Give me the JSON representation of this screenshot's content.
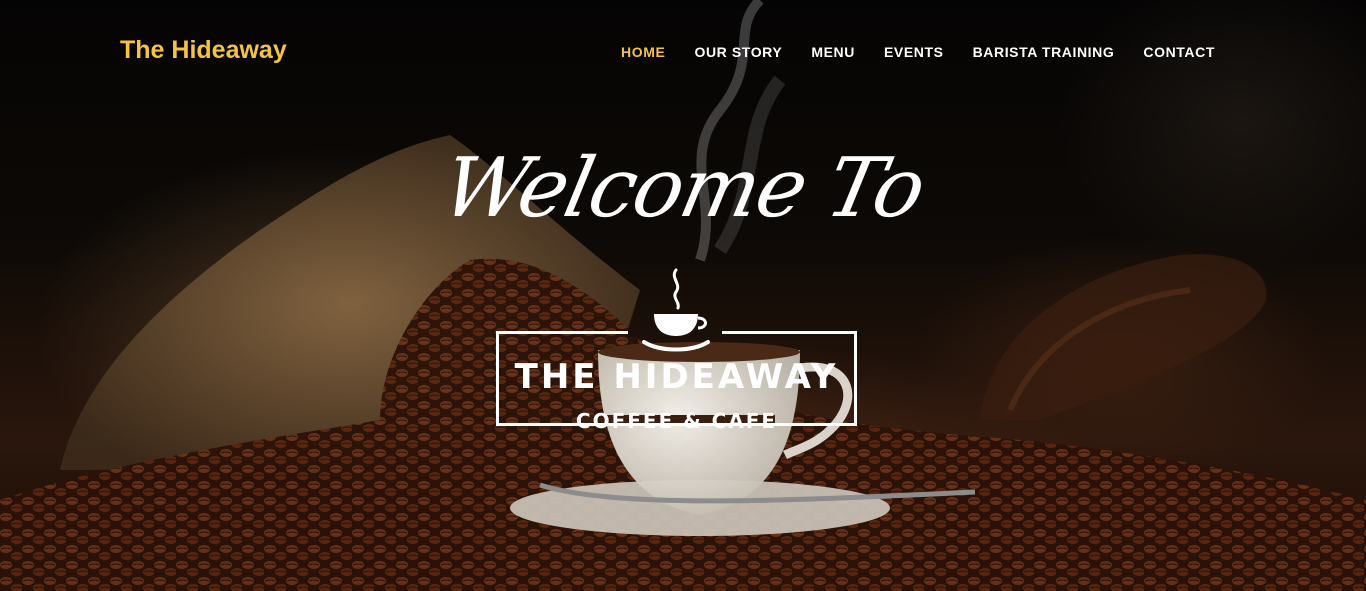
{
  "brand": {
    "name": "The Hideaway"
  },
  "nav": {
    "items": [
      {
        "label": "HOME",
        "active": true
      },
      {
        "label": "OUR STORY",
        "active": false
      },
      {
        "label": "MENU",
        "active": false
      },
      {
        "label": "EVENTS",
        "active": false
      },
      {
        "label": "BARISTA TRAINING",
        "active": false
      },
      {
        "label": "CONTACT",
        "active": false
      }
    ]
  },
  "hero": {
    "welcome": "Welcome To",
    "logo_name": "THE HIDEAWAY",
    "logo_tagline": "COFFEE & CAFE",
    "logo_icon": "coffee-cup-icon"
  },
  "colors": {
    "accent": "#f5c242",
    "text": "#ffffff",
    "background": "#0b0806"
  }
}
